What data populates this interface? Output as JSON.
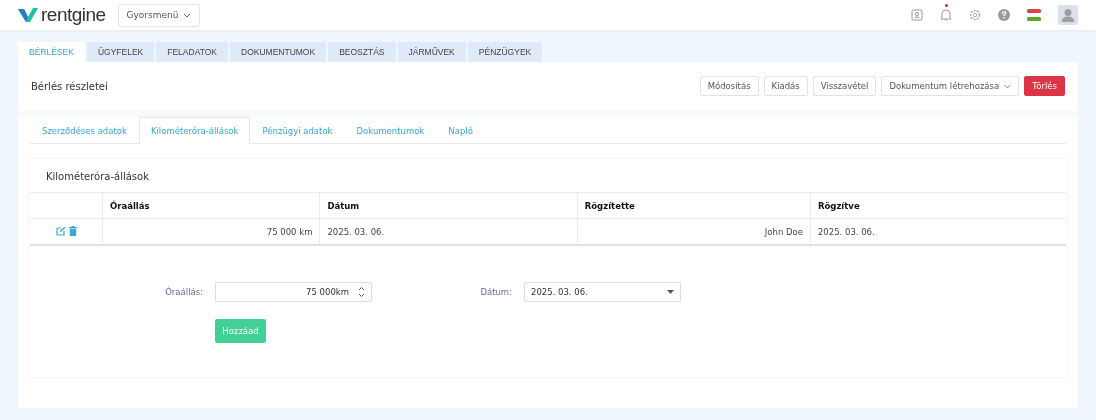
{
  "header": {
    "logo": "rentgine",
    "quick_menu": "Gyorsmenü",
    "notification": true
  },
  "main_tabs": [
    {
      "label": "BÉRLÉSEK",
      "selected": true
    },
    {
      "label": "ÜGYFELEK",
      "selected": false
    },
    {
      "label": "FELADATOK",
      "selected": false
    },
    {
      "label": "DOKUMENTUMOK",
      "selected": false
    },
    {
      "label": "BEOSZTÁS",
      "selected": false
    },
    {
      "label": "JÁRMŰVEK",
      "selected": false
    },
    {
      "label": "PÉNZÜGYEK",
      "selected": false
    }
  ],
  "page_title": "Bérlés részletei",
  "actions": [
    {
      "label": "Módosítás",
      "kind": "plain"
    },
    {
      "label": "Kiadás",
      "kind": "plain"
    },
    {
      "label": "Visszavétel",
      "kind": "plain"
    },
    {
      "label": "Dokumentum létrehozása",
      "kind": "dropdown"
    },
    {
      "label": "Törlés",
      "kind": "danger"
    }
  ],
  "sub_tabs": [
    {
      "label": "Szerződéses adatok",
      "selected": false
    },
    {
      "label": "Kilométeróra-állások",
      "selected": true
    },
    {
      "label": "Pénzügyi adatok",
      "selected": false
    },
    {
      "label": "Dokumentumok",
      "selected": false
    },
    {
      "label": "Napló",
      "selected": false
    }
  ],
  "card_title": "Kilométeróra-állások",
  "table": {
    "columns": [
      "Óraállás",
      "Dátum",
      "Rögzítette",
      "Rögzítve"
    ],
    "rows": [
      {
        "cells": [
          "75 000 km",
          "2025. 03. 06.",
          "John Doe",
          "2025. 03. 06."
        ]
      }
    ]
  },
  "form": {
    "reading_label": "Óraállás:",
    "reading_value": "75 000km",
    "date_label": "Dátum:",
    "date_value": "2025. 03. 06.",
    "submit": "Hozzáad"
  }
}
